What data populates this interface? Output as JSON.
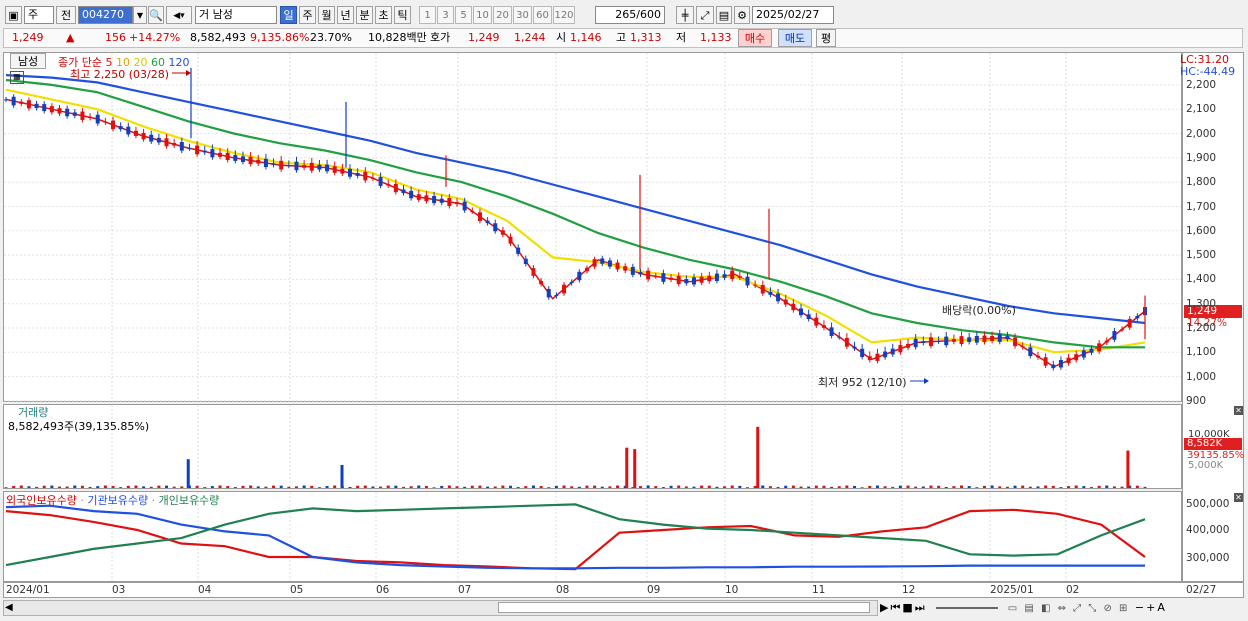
{
  "toolbar": {
    "type_select": "주",
    "prev_label": "전",
    "code": "004270",
    "company": "거 남성",
    "period_buttons": [
      "일",
      "주",
      "월",
      "년",
      "분",
      "초",
      "틱"
    ],
    "active_period": "일",
    "interval_buttons": [
      "1",
      "3",
      "5",
      "10",
      "20",
      "30",
      "60",
      "120"
    ],
    "count_current": "265",
    "count_max": "/600",
    "date": "2025/02/27"
  },
  "quote": {
    "price": "1,249",
    "change": "156",
    "change_pct": "+14.27%",
    "volume": "8,582,493",
    "volume_pct": "9,135.86%",
    "turnover": "23.70%",
    "amount": "10,828백만",
    "bid_label": "호가",
    "bid": "1,249",
    "ask": "1,244",
    "open_label": "시",
    "open": "1,146",
    "high_label": "고",
    "high": "1,313",
    "low_label": "저",
    "low": "1,133",
    "buy_label": "매수",
    "sell_label": "매도",
    "eval_label": "평"
  },
  "price_panel": {
    "stock_tab": "남성",
    "ma_label": "종가 단순",
    "ma_periods": [
      "5",
      "10",
      "20",
      "60",
      "120"
    ],
    "ma_colors": [
      "#e01010",
      "#e8a000",
      "#f0e000",
      "#20a040",
      "#2050e0"
    ],
    "high_note": "최고 2,250 (03/28)",
    "low_note": "최저 952 (12/10)",
    "dividend_note": "배당락(0.00%)",
    "lc": "LC:31.20",
    "hc": "HC:-44.49",
    "current_tag": "1,249",
    "pct_tag": "14.27%"
  },
  "volume_panel": {
    "title": "거래량",
    "value": "8,582,493주(39,135.85%)",
    "tag1": "8,582K",
    "tag2": "39135.85%",
    "scale_top": "10,000K",
    "scale_2": "5,000K"
  },
  "holding_panel": {
    "series": [
      "외국인보유수량",
      "기관보유수량",
      "개인보유수량"
    ],
    "ticks": [
      "500,000",
      "400,000",
      "300,000"
    ]
  },
  "chart_data": {
    "type": "line",
    "price_ticks": [
      "2,200",
      "2,100",
      "2,000",
      "1,900",
      "1,800",
      "1,700",
      "1,600",
      "1,500",
      "1,400",
      "1,300",
      "1,200",
      "1,100",
      "1,000",
      "900"
    ],
    "x_labels": [
      "2024/01",
      "03",
      "04",
      "05",
      "06",
      "07",
      "08",
      "09",
      "10",
      "11",
      "12",
      "2025/01",
      "02",
      "02/27"
    ],
    "series": [
      {
        "name": "5",
        "values": [
          2120,
          2080,
          2040,
          1970,
          1920,
          1880,
          1850,
          1840,
          1800,
          1720,
          1690,
          1560,
          1300,
          1460,
          1400,
          1370,
          1400,
          1300,
          1180,
          1050,
          1120,
          1130,
          1140,
          1020,
          1100,
          1249
        ]
      },
      {
        "name": "20",
        "values": [
          2160,
          2120,
          2080,
          2010,
          1950,
          1900,
          1860,
          1850,
          1820,
          1750,
          1710,
          1620,
          1470,
          1450,
          1410,
          1390,
          1390,
          1320,
          1230,
          1120,
          1140,
          1130,
          1130,
          1080,
          1090,
          1120
        ]
      },
      {
        "name": "60",
        "values": [
          2200,
          2180,
          2150,
          2090,
          2030,
          1980,
          1940,
          1910,
          1870,
          1820,
          1780,
          1720,
          1650,
          1570,
          1510,
          1460,
          1420,
          1370,
          1310,
          1240,
          1200,
          1170,
          1150,
          1120,
          1100,
          1100
        ]
      },
      {
        "name": "120",
        "values": [
          2220,
          2210,
          2190,
          2150,
          2110,
          2070,
          2030,
          1990,
          1950,
          1900,
          1860,
          1820,
          1770,
          1720,
          1670,
          1620,
          1570,
          1520,
          1460,
          1400,
          1350,
          1310,
          1270,
          1240,
          1220,
          1200
        ]
      }
    ],
    "volume_spikes": [
      {
        "x_frac": 0.16,
        "k": 4000
      },
      {
        "x_frac": 0.295,
        "k": 3200
      },
      {
        "x_frac": 0.545,
        "k": 5600
      },
      {
        "x_frac": 0.552,
        "k": 5400
      },
      {
        "x_frac": 0.66,
        "k": 8500
      },
      {
        "x_frac": 0.985,
        "k": 5200
      }
    ]
  }
}
